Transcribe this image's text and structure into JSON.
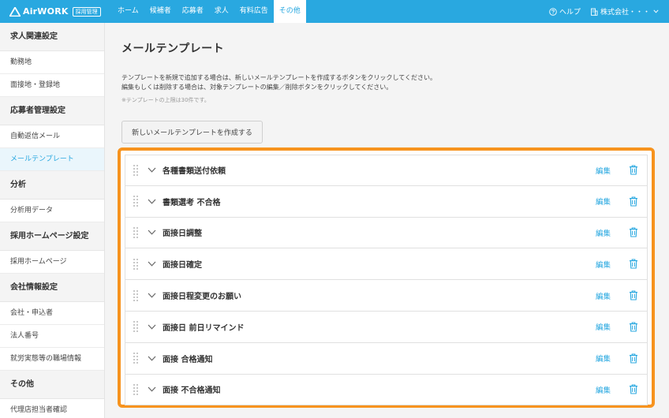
{
  "brand": {
    "name": "AirWORK",
    "badge": "採用管理"
  },
  "nav": [
    {
      "label": "ホーム"
    },
    {
      "label": "候補者"
    },
    {
      "label": "応募者"
    },
    {
      "label": "求人"
    },
    {
      "label": "有料広告"
    },
    {
      "label": "その他",
      "active": true
    }
  ],
  "header_right": {
    "help": "ヘルプ",
    "company": "株式会社・・・"
  },
  "sidebar": [
    {
      "type": "header",
      "label": "求人関連設定"
    },
    {
      "type": "item",
      "label": "勤務地"
    },
    {
      "type": "item",
      "label": "面接地・登録地"
    },
    {
      "type": "header",
      "label": "応募者管理設定"
    },
    {
      "type": "item",
      "label": "自動返信メール"
    },
    {
      "type": "item",
      "label": "メールテンプレート",
      "active": true
    },
    {
      "type": "header",
      "label": "分析"
    },
    {
      "type": "item",
      "label": "分析用データ"
    },
    {
      "type": "header",
      "label": "採用ホームページ設定"
    },
    {
      "type": "item",
      "label": "採用ホームページ"
    },
    {
      "type": "header",
      "label": "会社情報設定"
    },
    {
      "type": "item",
      "label": "会社・申込者"
    },
    {
      "type": "item",
      "label": "法人番号"
    },
    {
      "type": "item",
      "label": "就労実態等の職場情報"
    },
    {
      "type": "header",
      "label": "その他"
    },
    {
      "type": "item",
      "label": "代理店担当者確認"
    }
  ],
  "main": {
    "title": "メールテンプレート",
    "desc_line1": "テンプレートを新規で追加する場合は、新しいメールテンプレートを作成するボタンをクリックしてください。",
    "desc_line2": "編集もしくは削除する場合は、対象テンプレートの編集／削除ボタンをクリックしてください。",
    "note": "※テンプレートの上限は30件です。",
    "create_button": "新しいメールテンプレートを作成する",
    "edit_label": "編集",
    "templates": [
      {
        "name": "各種書類送付依頼"
      },
      {
        "name": "書類選考 不合格"
      },
      {
        "name": "面接日調整"
      },
      {
        "name": "面接日確定"
      },
      {
        "name": "面接日程変更のお願い"
      },
      {
        "name": "面接日 前日リマインド"
      },
      {
        "name": "面接 合格通知"
      },
      {
        "name": "面接 不合格通知"
      }
    ]
  },
  "colors": {
    "brand_blue": "#29a8e0",
    "highlight_orange": "#f7931e"
  }
}
